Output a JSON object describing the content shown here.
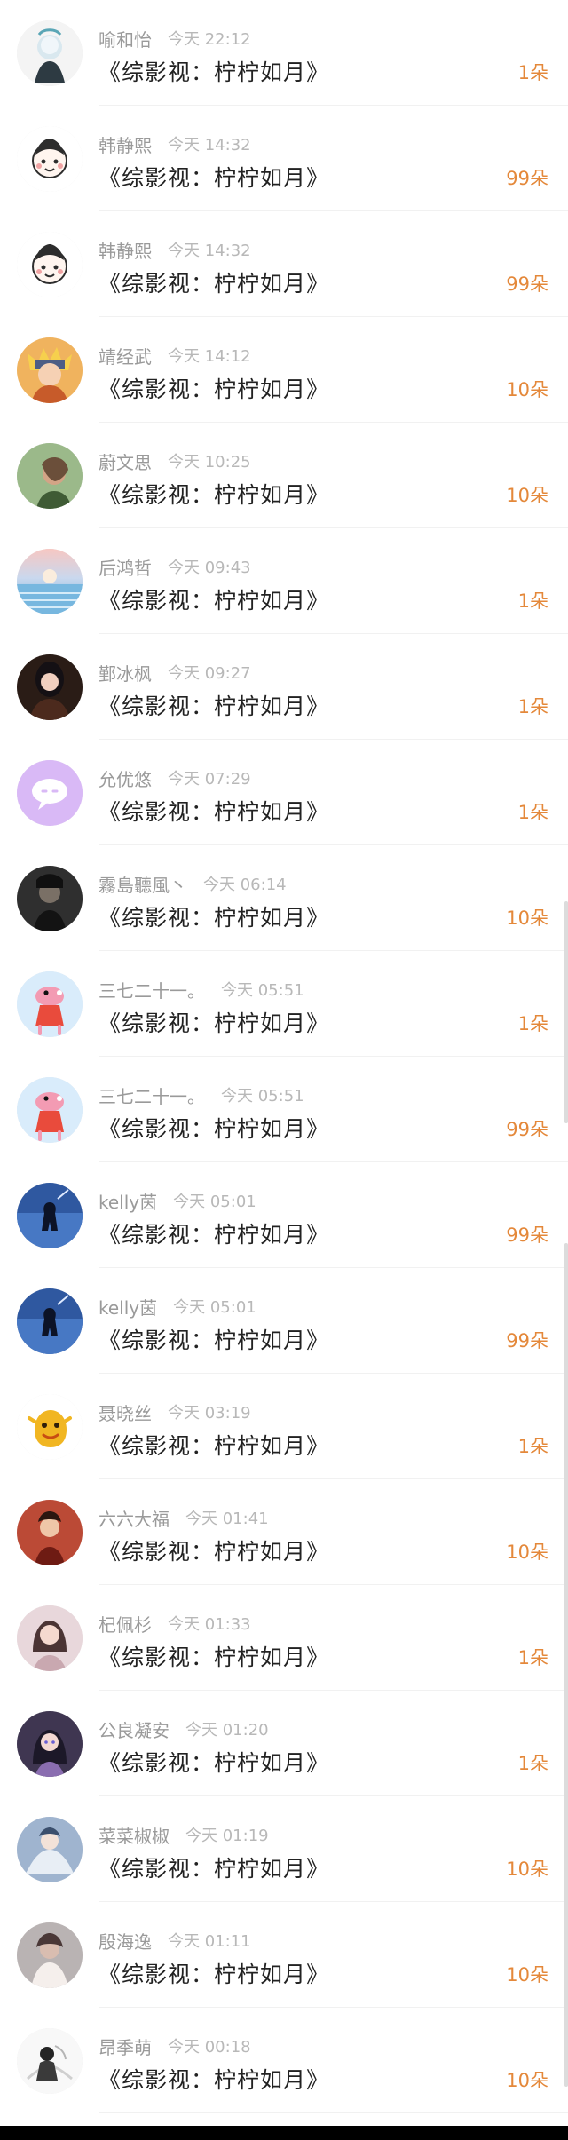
{
  "feed": {
    "items": [
      {
        "name": "喻和怡",
        "time": "今天 22:12",
        "work": "《综影视：柠柠如月》",
        "amount": "1朵",
        "avatar_icon": "anime-girl-avatar-icon"
      },
      {
        "name": "韩静熙",
        "time": "今天 14:32",
        "work": "《综影视：柠柠如月》",
        "amount": "99朵",
        "avatar_icon": "cartoon-girl-avatar-icon"
      },
      {
        "name": "韩静熙",
        "time": "今天 14:32",
        "work": "《综影视：柠柠如月》",
        "amount": "99朵",
        "avatar_icon": "cartoon-girl-avatar-icon"
      },
      {
        "name": "靖经武",
        "time": "今天 14:12",
        "work": "《综影视：柠柠如月》",
        "amount": "10朵",
        "avatar_icon": "anime-ninja-avatar-icon"
      },
      {
        "name": "蔚文思",
        "time": "今天 10:25",
        "work": "《综影视：柠柠如月》",
        "amount": "10朵",
        "avatar_icon": "portrait-avatar-icon"
      },
      {
        "name": "后鸿哲",
        "time": "今天 09:43",
        "work": "《综影视：柠柠如月》",
        "amount": "1朵",
        "avatar_icon": "ocean-sunset-avatar-icon"
      },
      {
        "name": "鄞冰枫",
        "time": "今天 09:27",
        "work": "《综影视：柠柠如月》",
        "amount": "1朵",
        "avatar_icon": "woman-photo-avatar-icon"
      },
      {
        "name": "允优悠",
        "time": "今天 07:29",
        "work": "《综影视：柠柠如月》",
        "amount": "1朵",
        "avatar_icon": "chat-bubble-avatar-icon"
      },
      {
        "name": "霧島聽風丶",
        "time": "今天 06:14",
        "work": "《综影视：柠柠如月》",
        "amount": "10朵",
        "avatar_icon": "dark-portrait-avatar-icon"
      },
      {
        "name": "三七二十一。",
        "time": "今天 05:51",
        "work": "《综影视：柠柠如月》",
        "amount": "1朵",
        "avatar_icon": "peppa-pig-avatar-icon"
      },
      {
        "name": "三七二十一。",
        "time": "今天 05:51",
        "work": "《综影视：柠柠如月》",
        "amount": "99朵",
        "avatar_icon": "peppa-pig-avatar-icon"
      },
      {
        "name": "kelly茵",
        "time": "今天 05:01",
        "work": "《综影视：柠柠如月》",
        "amount": "99朵",
        "avatar_icon": "sea-silhouette-avatar-icon"
      },
      {
        "name": "kelly茵",
        "time": "今天 05:01",
        "work": "《综影视：柠柠如月》",
        "amount": "99朵",
        "avatar_icon": "sea-silhouette-avatar-icon"
      },
      {
        "name": "聂晓丝",
        "time": "今天 03:19",
        "work": "《综影视：柠柠如月》",
        "amount": "1朵",
        "avatar_icon": "yellow-cartoon-avatar-icon"
      },
      {
        "name": "六六大福",
        "time": "今天 01:41",
        "work": "《综影视：柠柠如月》",
        "amount": "10朵",
        "avatar_icon": "red-portrait-avatar-icon"
      },
      {
        "name": "杞佩杉",
        "time": "今天 01:33",
        "work": "《综影视：柠柠如月》",
        "amount": "1朵",
        "avatar_icon": "woman-portrait-avatar-icon"
      },
      {
        "name": "公良凝安",
        "time": "今天 01:20",
        "work": "《综影视：柠柠如月》",
        "amount": "1朵",
        "avatar_icon": "anime-girl-dark-avatar-icon"
      },
      {
        "name": "菜菜椒椒",
        "time": "今天 01:19",
        "work": "《综影视：柠柠如月》",
        "amount": "10朵",
        "avatar_icon": "blue-painting-avatar-icon"
      },
      {
        "name": "殷海逸",
        "time": "今天 01:11",
        "work": "《综影视：柠柠如月》",
        "amount": "10朵",
        "avatar_icon": "soft-portrait-avatar-icon"
      },
      {
        "name": "昂季萌",
        "time": "今天 00:18",
        "work": "《综影视：柠柠如月》",
        "amount": "10朵",
        "avatar_icon": "ink-painting-avatar-icon"
      }
    ]
  },
  "colors": {
    "amount": "#e4883a",
    "name": "#9a9a9a",
    "time": "#b8b8b8",
    "title": "#222222"
  }
}
